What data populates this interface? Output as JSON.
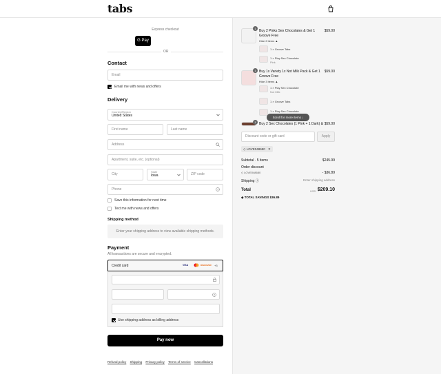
{
  "header": {
    "logo": "tabs"
  },
  "express": {
    "label": "Express checkout",
    "gpay": "G Pay",
    "or": "OR"
  },
  "contact": {
    "title": "Contact",
    "email_placeholder": "Email",
    "news_label": "Email me with news and offers"
  },
  "delivery": {
    "title": "Delivery",
    "country_label": "Country/Region",
    "country_value": "United States",
    "first_name": "First name",
    "last_name": "Last name",
    "address": "Address",
    "apartment": "Apartment, suite, etc. (optional)",
    "city": "City",
    "state_label": "State",
    "state_value": "Iowa",
    "zip": "ZIP code",
    "phone": "Phone",
    "save_label": "Save this information for next time",
    "text_label": "Text me with news and offers"
  },
  "shipping": {
    "title": "Shipping method",
    "message": "Enter your shipping address to view available shipping methods."
  },
  "payment": {
    "title": "Payment",
    "subtitle": "All transactions are secure and encrypted.",
    "method": "Credit card",
    "cards": [
      "VISA",
      "MC",
      "DISCOVER",
      "+3"
    ],
    "billing_label": "Use shipping address as billing address",
    "pay_button": "Pay now"
  },
  "footer": [
    "Refund policy",
    "Shipping",
    "Privacy policy",
    "Terms of service",
    "Cancellations"
  ],
  "cart": {
    "items": [
      {
        "qty": "1",
        "name": "Buy 2 Pinks Sex Chocolates & Get 1",
        "name2": "Groove Free",
        "price": "$59.00",
        "toggle": "Hide 2 items ▲",
        "subs": [
          {
            "name": "1 × Groove Tabs",
            "detail": ""
          },
          {
            "name": "1 × Play Sex Chocolate",
            "detail": "Pink"
          }
        ]
      },
      {
        "qty": "1",
        "name": "Buy 1x Variety 1x Not Milk Pack & Get 1",
        "name2": "Groove Free",
        "price": "$59.00",
        "toggle": "Hide 3 items ▲",
        "subs": [
          {
            "name": "1 × Play Sex Chocolate",
            "detail": "Not Milk"
          },
          {
            "name": "1 × Groove Tabs",
            "detail": ""
          },
          {
            "name": "1 × Play Sex Chocolate",
            "detail": ""
          }
        ]
      },
      {
        "qty": "1",
        "name": "Buy 2 Sex Chocolates (1 Pink + 1 Dark) &",
        "name2": "",
        "price": "$59.00",
        "toggle": "",
        "subs": []
      }
    ],
    "scroll_hint": "Scroll for more items ↓",
    "discount_placeholder": "Discount code or gift card",
    "apply": "Apply",
    "code": "LOVE048680",
    "subtotal_label": "Subtotal · 5 items",
    "subtotal_value": "$245.99",
    "order_discount_label": "Order discount",
    "order_discount_code": "LOVE048680",
    "order_discount_value": "- $36.89",
    "shipping_label": "Shipping",
    "shipping_value": "Enter shipping address",
    "total_label": "Total",
    "currency": "USD",
    "total_value": "$209.10",
    "savings_label": "TOTAL SAVINGS",
    "savings_value": "$36.89"
  }
}
